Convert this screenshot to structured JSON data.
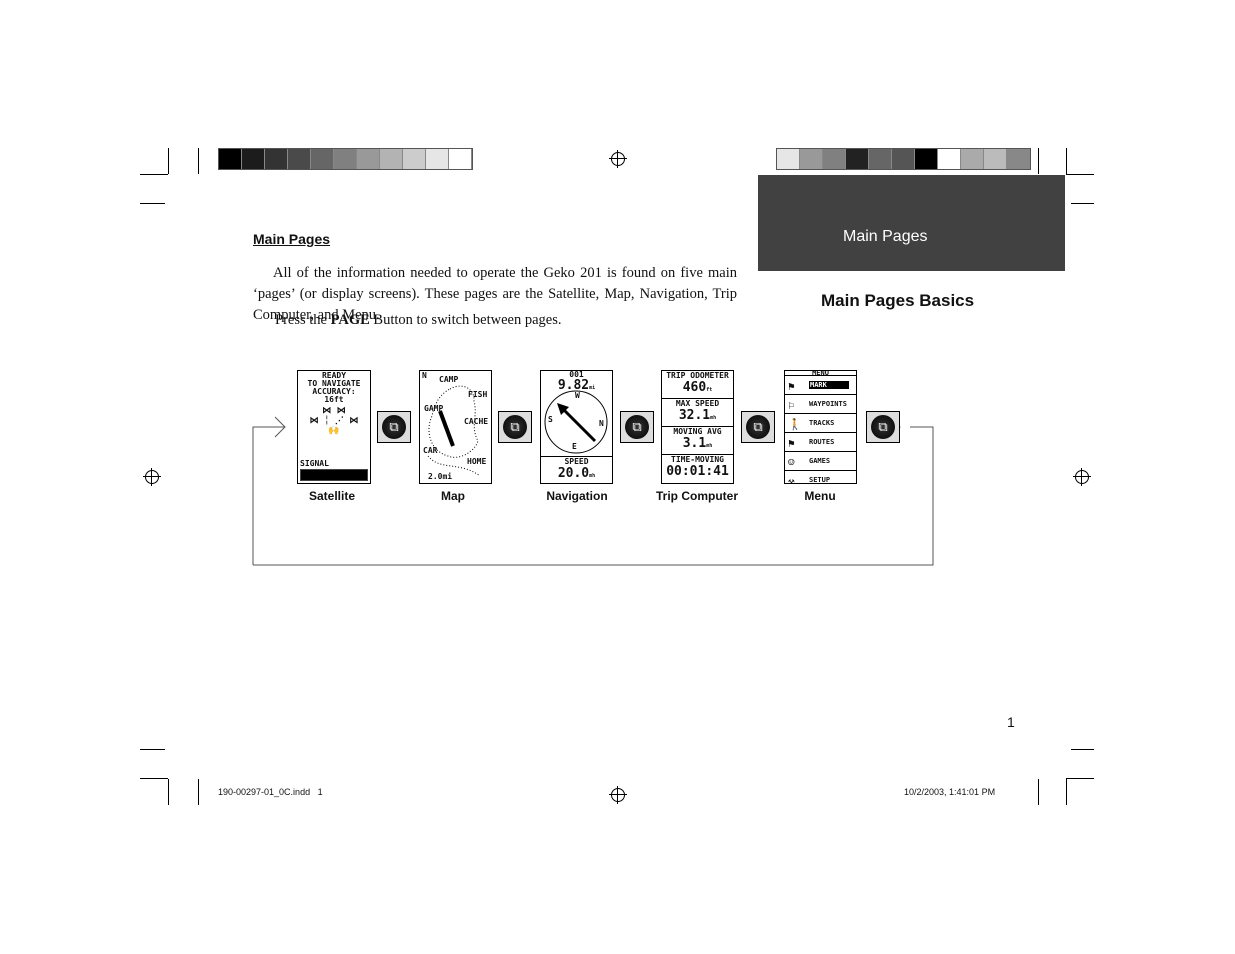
{
  "section_tab": "Main Pages",
  "section_subtitle": "Main Pages Basics",
  "heading": "Main Pages",
  "paragraph1": "All of the information needed to operate the Geko 201 is found on five main ‘pages’ (or display screens). These pages are the Satellite, Map, Navigation, Trip Computer, and Menu.",
  "paragraph2_pre": "Press the ",
  "paragraph2_bold": "PAGE",
  "paragraph2_post": " Button to switch between pages.",
  "page_number": "1",
  "footer_left": "190-00297-01_0C.indd   1",
  "footer_right": "10/2/2003, 1:41:01 PM",
  "page_button_icon": "page-button-icon",
  "screens": {
    "satellite": {
      "caption": "Satellite",
      "l1": "READY",
      "l2": "TO NAVIGATE",
      "l3": "ACCURACY:",
      "l4": "16ft",
      "signal": "SIGNAL"
    },
    "map": {
      "caption": "Map",
      "north": "N",
      "camp": "CAMP",
      "fish": "FISH",
      "gamp": "GAMP",
      "cache": "CACHE",
      "car": "CAR",
      "home": "HOME",
      "scale": "2.0mi"
    },
    "navigation": {
      "caption": "Navigation",
      "wpt": "001",
      "dist": "9.82",
      "dist_unit": "mi",
      "w": "W",
      "s": "S",
      "n": "N",
      "e": "E",
      "speed_label": "SPEED",
      "speed": "20.0",
      "speed_unit": "mh"
    },
    "trip": {
      "caption": "Trip Computer",
      "odo_label": "TRIP ODOMETER",
      "odo": "460",
      "odo_unit": "ft",
      "max_label": "MAX SPEED",
      "max": "32.1",
      "max_unit": "mh",
      "avg_label": "MOVING AVG",
      "avg": "3.1",
      "avg_unit": "mh",
      "time_label": "TIME-MOVING",
      "time": "00:01:41"
    },
    "menu": {
      "caption": "Menu",
      "title": "MENU",
      "items": [
        "MARK",
        "WAYPOINTS",
        "TRACKS",
        "ROUTES",
        "GAMES",
        "SETUP"
      ]
    }
  }
}
